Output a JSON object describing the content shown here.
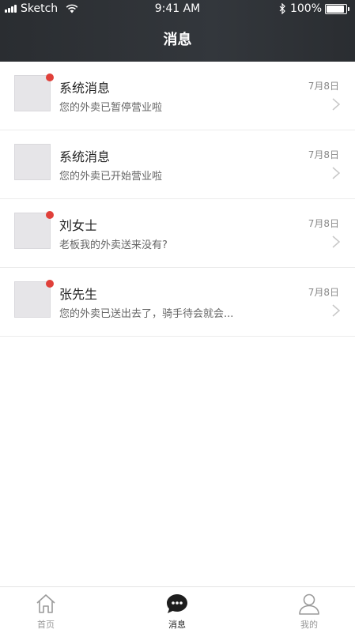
{
  "status_bar": {
    "carrier": "Sketch",
    "time": "9:41 AM",
    "battery": "100%"
  },
  "nav": {
    "title": "消息"
  },
  "messages": [
    {
      "title": "系统消息",
      "preview": "您的外卖已暂停营业啦",
      "date": "7月8日",
      "unread": true
    },
    {
      "title": "系统消息",
      "preview": "您的外卖已开始营业啦",
      "date": "7月8日",
      "unread": false
    },
    {
      "title": "刘女士",
      "preview": "老板我的外卖送来没有?",
      "date": "7月8日",
      "unread": true
    },
    {
      "title": "张先生",
      "preview": "您的外卖已送出去了，骑手待会就会...",
      "date": "7月8日",
      "unread": true
    }
  ],
  "tabbar": {
    "items": [
      {
        "label": "首页",
        "icon": "home-icon",
        "active": false
      },
      {
        "label": "消息",
        "icon": "chat-bubble-icon",
        "active": true
      },
      {
        "label": "我的",
        "icon": "user-icon",
        "active": false
      }
    ]
  },
  "colors": {
    "header_bg": "#2f3237",
    "unread_dot": "#e0403a",
    "avatar_placeholder": "#e6e5e8"
  }
}
